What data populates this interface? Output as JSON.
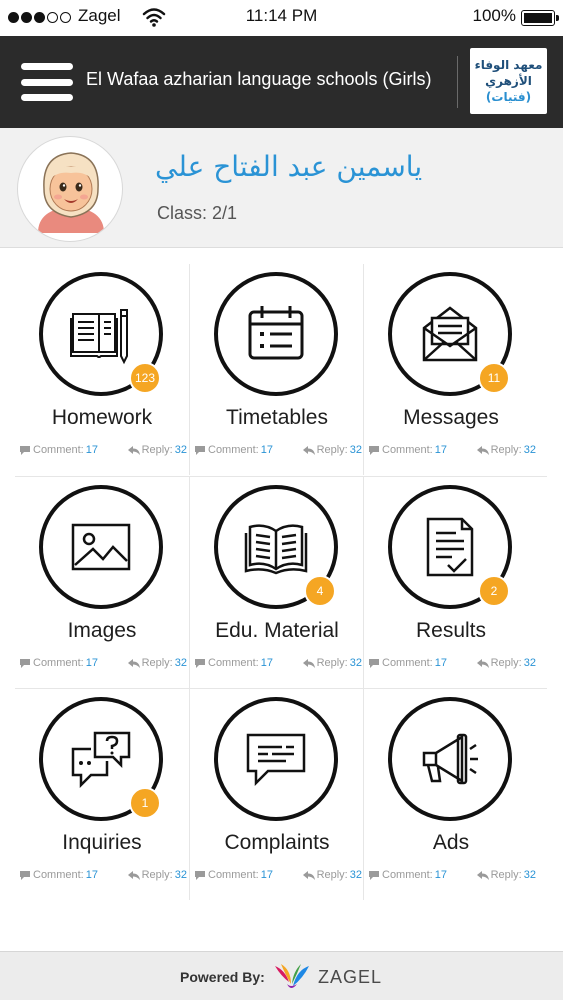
{
  "status_bar": {
    "carrier": "Zagel",
    "time": "11:14 PM",
    "battery": "100%"
  },
  "header": {
    "title": "El Wafaa azharian language schools (Girls)",
    "logo_lines": [
      "معهد الوفاء",
      "الأزهري",
      "(فتيات)"
    ]
  },
  "profile": {
    "name": "ياسمين عبد الفتاح علي",
    "class_label": "Class: 2/1"
  },
  "grid": {
    "items": [
      {
        "label": "Homework",
        "icon": "book-pencil-icon",
        "badge": "123",
        "comment_label": "Comment:",
        "comment_count": "17",
        "reply_label": "Reply:",
        "reply_count": "32"
      },
      {
        "label": "Timetables",
        "icon": "calendar-icon",
        "badge": "",
        "comment_label": "Comment:",
        "comment_count": "17",
        "reply_label": "Reply:",
        "reply_count": "32"
      },
      {
        "label": "Messages",
        "icon": "envelope-icon",
        "badge": "11",
        "comment_label": "Comment:",
        "comment_count": "17",
        "reply_label": "Reply:",
        "reply_count": "32"
      },
      {
        "label": "Images",
        "icon": "image-icon",
        "badge": "",
        "comment_label": "Comment:",
        "comment_count": "17",
        "reply_label": "Reply:",
        "reply_count": "32"
      },
      {
        "label": "Edu. Material",
        "icon": "open-book-icon",
        "badge": "4",
        "comment_label": "Comment:",
        "comment_count": "17",
        "reply_label": "Reply:",
        "reply_count": "32"
      },
      {
        "label": "Results",
        "icon": "document-check-icon",
        "badge": "2",
        "comment_label": "Comment:",
        "comment_count": "17",
        "reply_label": "Reply:",
        "reply_count": "32"
      },
      {
        "label": "Inquiries",
        "icon": "chat-question-icon",
        "badge": "1",
        "comment_label": "Comment:",
        "comment_count": "17",
        "reply_label": "Reply:",
        "reply_count": "32"
      },
      {
        "label": "Complaints",
        "icon": "speech-bubble-icon",
        "badge": "",
        "comment_label": "Comment:",
        "comment_count": "17",
        "reply_label": "Reply:",
        "reply_count": "32"
      },
      {
        "label": "Ads",
        "icon": "megaphone-icon",
        "badge": "",
        "comment_label": "Comment:",
        "comment_count": "17",
        "reply_label": "Reply:",
        "reply_count": "32"
      }
    ]
  },
  "footer": {
    "powered_by": "Powered By:",
    "brand": "ZAGEL"
  },
  "colors": {
    "header_bg": "#2b2b2b",
    "accent_blue": "#2a93d5",
    "badge_orange": "#f5a623"
  }
}
